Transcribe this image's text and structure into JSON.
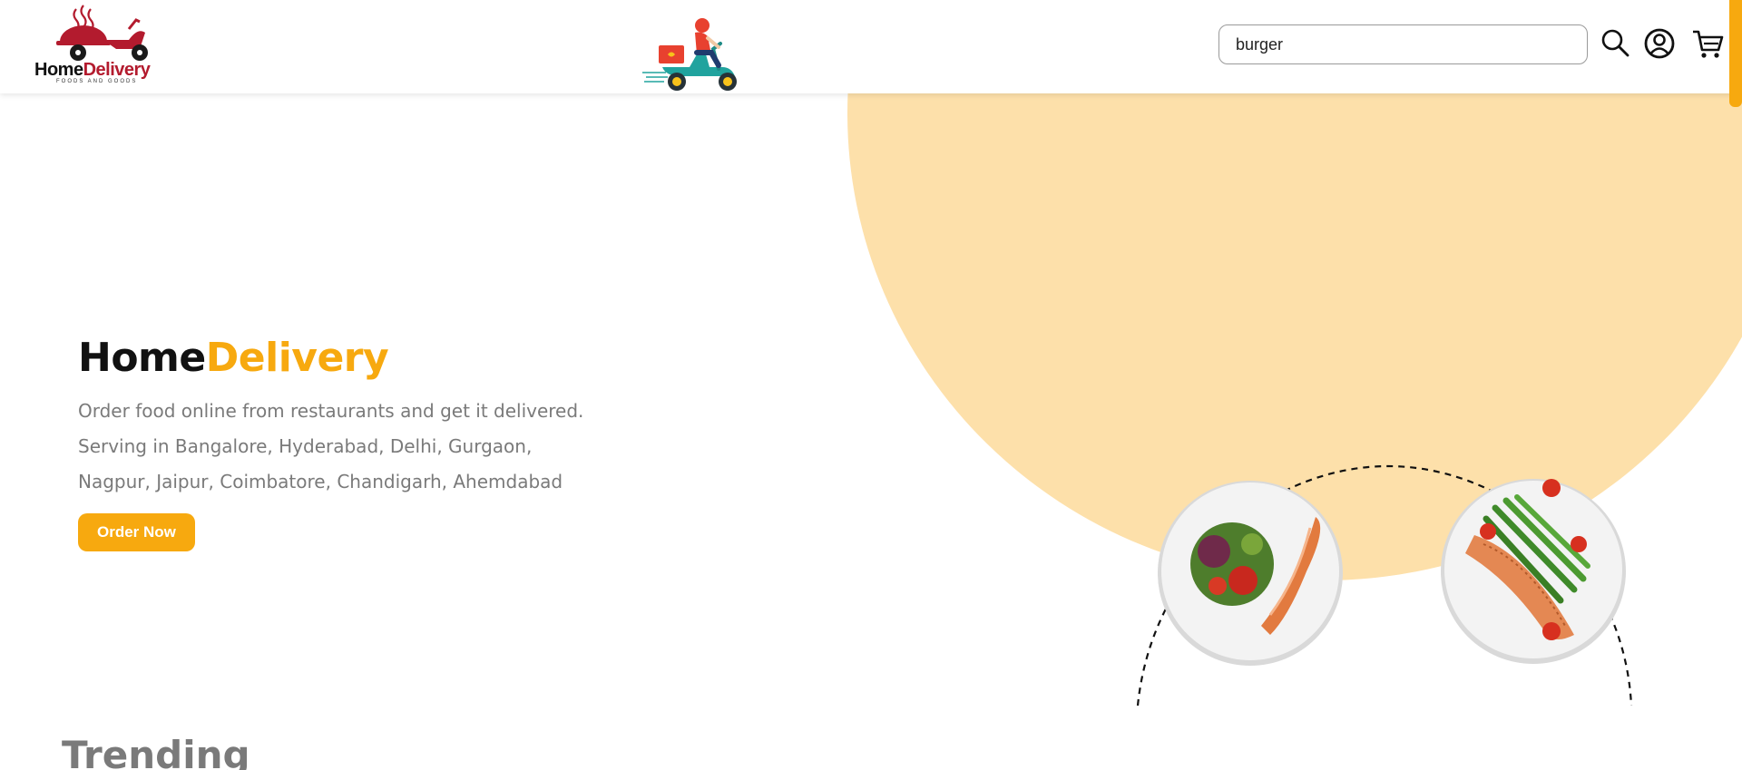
{
  "header": {
    "logo": {
      "word_a": "Home",
      "word_b": "Delivery",
      "tagline": "FOODS AND GOODS"
    },
    "search": {
      "value": "burger",
      "placeholder": ""
    },
    "icons": [
      "search-icon",
      "user-account-icon",
      "cart-icon"
    ]
  },
  "hero": {
    "title_part1": "Home",
    "title_part2": "Delivery",
    "desc_line1": "Order food online from restaurants and get it delivered.",
    "desc_line2": "Serving in Bangalore, Hyderabad, Delhi, Gurgaon,",
    "desc_line3": "Nagpur, Jaipur, Coimbatore, Chandigarh, Ahemdabad",
    "cta": "Order Now"
  },
  "sections": {
    "trending_title": "Trending"
  },
  "colors": {
    "accent": "#f7a90f",
    "blob": "#fde0aa",
    "logo_red": "#b31b2e",
    "scooter_teal": "#20a39e",
    "text_muted": "#7a7a7a"
  }
}
